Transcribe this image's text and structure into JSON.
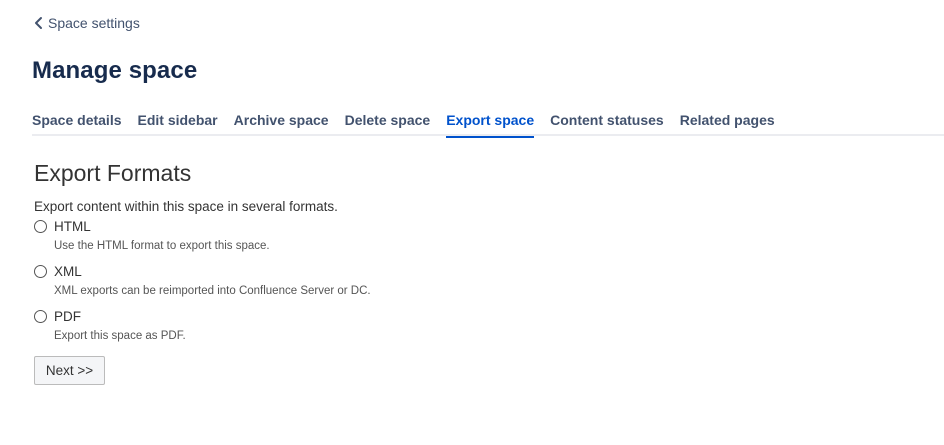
{
  "breadcrumb": {
    "back_label": "Space settings"
  },
  "page": {
    "title": "Manage space"
  },
  "tabs": [
    {
      "label": "Space details"
    },
    {
      "label": "Edit sidebar"
    },
    {
      "label": "Archive space"
    },
    {
      "label": "Delete space"
    },
    {
      "label": "Export space",
      "active": true
    },
    {
      "label": "Content statuses"
    },
    {
      "label": "Related pages"
    }
  ],
  "export": {
    "title": "Export Formats",
    "intro": "Export content within this space in several formats.",
    "options": [
      {
        "label": "HTML",
        "description": "Use the HTML format to export this space.",
        "selected": false
      },
      {
        "label": "XML",
        "description": "XML exports can be reimported into Confluence Server or DC.",
        "selected": false
      },
      {
        "label": "PDF",
        "description": "Export this space as PDF.",
        "selected": false
      }
    ],
    "next_label": "Next >>"
  },
  "colors": {
    "accent": "#0052cc",
    "tab_text": "#42526e",
    "heading": "#172b4d"
  },
  "icons": {
    "back": "chevron-left-icon"
  }
}
